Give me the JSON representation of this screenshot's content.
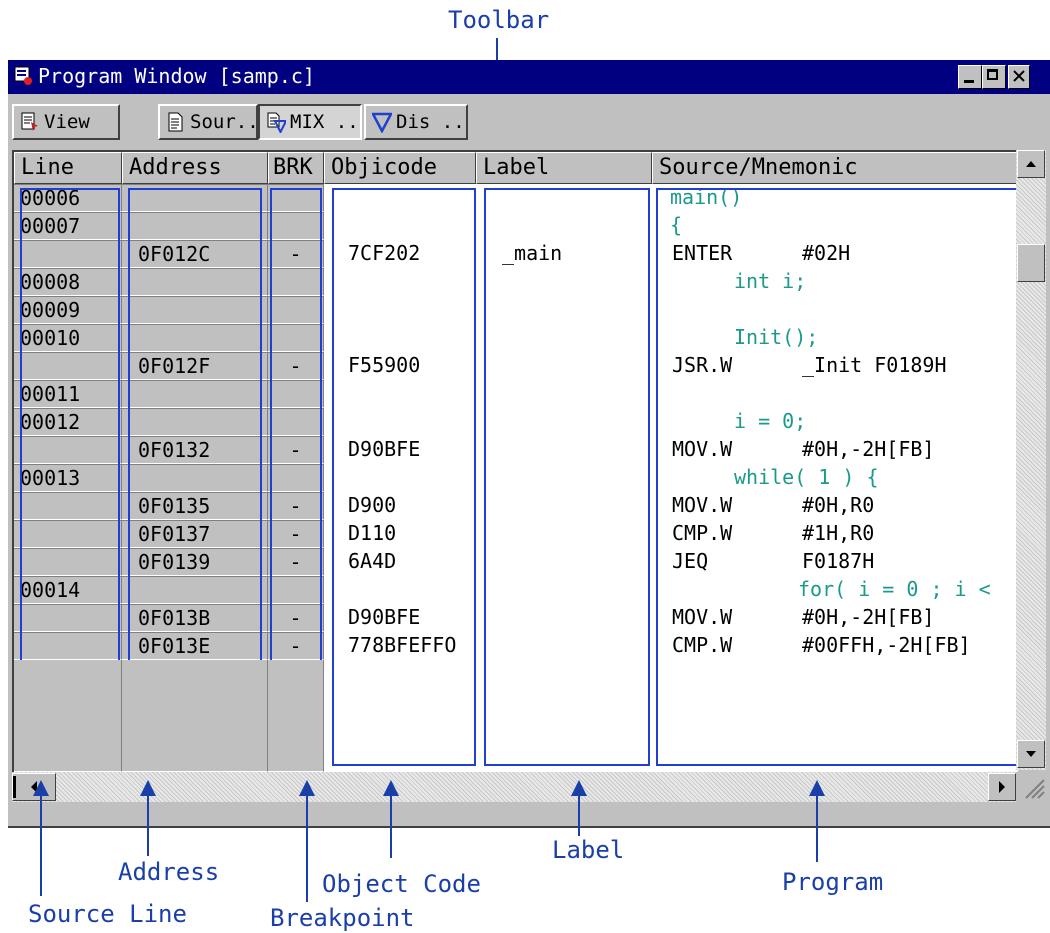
{
  "annotations": {
    "toolbar": "Toolbar",
    "address": "Address",
    "source_line": "Source Line",
    "breakpoint": "Breakpoint",
    "object_code": "Object Code",
    "label": "Label",
    "program": "Program"
  },
  "window": {
    "title": "Program Window [samp.c]"
  },
  "toolbar": {
    "view_label": "View",
    "sour_label": "Sour...",
    "mix_label": "MIX ...",
    "dis_label": "Dis ..."
  },
  "columns": {
    "line": "Line",
    "address": "Address",
    "brk": "BRK",
    "objcode": "Objicode",
    "label": "Label",
    "source": "Source/Mnemonic"
  },
  "rows": [
    {
      "line": "00006",
      "address": "",
      "brk": "",
      "obj": "",
      "label": "",
      "src": "main()",
      "src_type": "c",
      "indent": 0
    },
    {
      "line": "00007",
      "address": "",
      "brk": "",
      "obj": "",
      "label": "",
      "src": "{",
      "src_type": "c",
      "indent": 0
    },
    {
      "line": "",
      "address": "0F012C",
      "brk": "-",
      "obj": "7CF202",
      "label": "_main",
      "src": "ENTER",
      "operand": "#02H",
      "src_type": "asm"
    },
    {
      "line": "00008",
      "address": "",
      "brk": "",
      "obj": "",
      "label": "",
      "src": "int i;",
      "src_type": "c",
      "indent": 1
    },
    {
      "line": "00009",
      "address": "",
      "brk": "",
      "obj": "",
      "label": "",
      "src": "",
      "src_type": "c",
      "indent": 1
    },
    {
      "line": "00010",
      "address": "",
      "brk": "",
      "obj": "",
      "label": "",
      "src": "Init();",
      "src_type": "c",
      "indent": 1
    },
    {
      "line": "",
      "address": "0F012F",
      "brk": "-",
      "obj": "F55900",
      "label": "",
      "src": "JSR.W",
      "operand": "_Init F0189H",
      "src_type": "asm"
    },
    {
      "line": "00011",
      "address": "",
      "brk": "",
      "obj": "",
      "label": "",
      "src": "",
      "src_type": "c",
      "indent": 1
    },
    {
      "line": "00012",
      "address": "",
      "brk": "",
      "obj": "",
      "label": "",
      "src": "i = 0;",
      "src_type": "c",
      "indent": 1
    },
    {
      "line": "",
      "address": "0F0132",
      "brk": "-",
      "obj": "D90BFE",
      "label": "",
      "src": "MOV.W",
      "operand": "#0H,-2H[FB]",
      "src_type": "asm"
    },
    {
      "line": "00013",
      "address": "",
      "brk": "",
      "obj": "",
      "label": "",
      "src": "while( 1 ) {",
      "src_type": "c",
      "indent": 1
    },
    {
      "line": "",
      "address": "0F0135",
      "brk": "-",
      "obj": "D900",
      "label": "",
      "src": "MOV.W",
      "operand": "#0H,R0",
      "src_type": "asm"
    },
    {
      "line": "",
      "address": "0F0137",
      "brk": "-",
      "obj": "D110",
      "label": "",
      "src": "CMP.W",
      "operand": "#1H,R0",
      "src_type": "asm"
    },
    {
      "line": "",
      "address": "0F0139",
      "brk": "-",
      "obj": "6A4D",
      "label": "",
      "src": "JEQ",
      "operand": "F0187H",
      "src_type": "asm"
    },
    {
      "line": "00014",
      "address": "",
      "brk": "",
      "obj": "",
      "label": "",
      "src": "for( i = 0 ; i <",
      "src_type": "c",
      "indent": 2
    },
    {
      "line": "",
      "address": "0F013B",
      "brk": "-",
      "obj": "D90BFE",
      "label": "",
      "src": "MOV.W",
      "operand": "#0H,-2H[FB]",
      "src_type": "asm"
    },
    {
      "line": "",
      "address": "0F013E",
      "brk": "-",
      "obj": "778BFEFFO",
      "label": "",
      "src": "CMP.W",
      "operand": "#00FFH,-2H[FB]",
      "src_type": "asm"
    }
  ],
  "colors": {
    "title_bar": "#000080",
    "outline": "#1f3fd0",
    "c_source": "#1a9a8a",
    "annotation": "#1a3fa8"
  }
}
